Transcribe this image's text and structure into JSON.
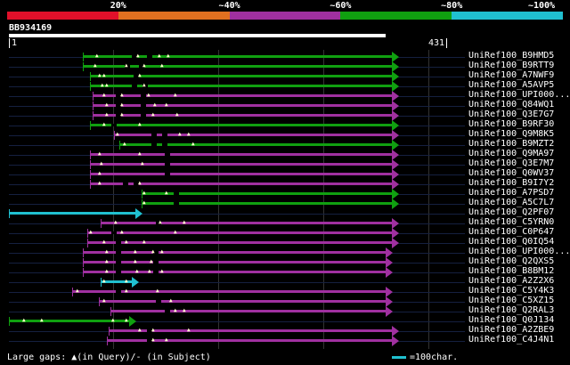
{
  "legend": {
    "segments": [
      {
        "color": "#e0102a"
      },
      {
        "color": "#e07020"
      },
      {
        "color": "#a030a0"
      },
      {
        "color": "#10a010"
      },
      {
        "color": "#20c0d0"
      }
    ],
    "labels": [
      "20%",
      "~40%",
      "~60%",
      "~80%",
      "~100%"
    ]
  },
  "query": {
    "id": "BB934169",
    "start": "1",
    "end": "431"
  },
  "hits": [
    {
      "name": "UniRef100_B9HMD5",
      "color": "#10a010",
      "start": 93,
      "end": 440,
      "arrow": true,
      "gaps": [
        148,
        165
      ],
      "marks": [
        107,
        153,
        177,
        187
      ]
    },
    {
      "name": "UniRef100_B9RTT9",
      "color": "#10a010",
      "start": 93,
      "end": 440,
      "arrow": true,
      "gaps": [
        140,
        156
      ],
      "marks": [
        105,
        140,
        160,
        180
      ]
    },
    {
      "name": "UniRef100_A7NWF9",
      "color": "#10a010",
      "start": 101,
      "end": 440,
      "arrow": true,
      "gaps": [
        150
      ],
      "marks": [
        110,
        115,
        155
      ]
    },
    {
      "name": "UniRef100_A5AVP5",
      "color": "#10a010",
      "start": 101,
      "end": 440,
      "arrow": true,
      "gaps": [
        148,
        160
      ],
      "marks": [
        113,
        118,
        160
      ]
    },
    {
      "name": "UniRef100_UPI000...",
      "color": "#a030a0",
      "start": 104,
      "end": 440,
      "arrow": true,
      "gaps": [
        130,
        158
      ],
      "marks": [
        115,
        135,
        165,
        195
      ]
    },
    {
      "name": "UniRef100_Q84WQ1",
      "color": "#a030a0",
      "start": 104,
      "end": 440,
      "arrow": true,
      "gaps": [
        130,
        158
      ],
      "marks": [
        118,
        135,
        172,
        185
      ]
    },
    {
      "name": "UniRef100_Q3E7G7",
      "color": "#a030a0",
      "start": 104,
      "end": 440,
      "arrow": true,
      "gaps": [
        130,
        158
      ],
      "marks": [
        118,
        135,
        170,
        197
      ]
    },
    {
      "name": "UniRef100_B9RF30",
      "color": "#10a010",
      "start": 101,
      "end": 440,
      "arrow": true,
      "gaps": [
        125
      ],
      "marks": [
        115,
        155
      ]
    },
    {
      "name": "UniRef100_Q9M8K5",
      "color": "#a030a0",
      "start": 128,
      "end": 440,
      "arrow": true,
      "gaps": [
        170,
        182
      ],
      "marks": [
        130,
        200,
        210
      ]
    },
    {
      "name": "UniRef100_B9MZT2",
      "color": "#10a010",
      "start": 134,
      "end": 440,
      "arrow": true,
      "gaps": [
        170,
        182
      ],
      "marks": [
        138,
        215
      ]
    },
    {
      "name": "UniRef100_Q9MA97",
      "color": "#a030a0",
      "start": 101,
      "end": 440,
      "arrow": true,
      "gaps": [
        185
      ],
      "marks": [
        110,
        155
      ]
    },
    {
      "name": "UniRef100_Q3E7M7",
      "color": "#a030a0",
      "start": 101,
      "end": 440,
      "arrow": true,
      "gaps": [
        185
      ],
      "marks": [
        112,
        158
      ]
    },
    {
      "name": "UniRef100_Q0WV37",
      "color": "#a030a0",
      "start": 101,
      "end": 440,
      "arrow": true,
      "gaps": [
        185
      ],
      "marks": [
        110
      ]
    },
    {
      "name": "UniRef100_B9I7Y2",
      "color": "#a030a0",
      "start": 101,
      "end": 440,
      "arrow": true,
      "gaps": [
        138,
        150
      ],
      "marks": [
        110,
        155
      ]
    },
    {
      "name": "UniRef100_A7PSD7",
      "color": "#10a010",
      "start": 159,
      "end": 440,
      "arrow": true,
      "gaps": [
        195
      ],
      "marks": [
        160,
        185
      ]
    },
    {
      "name": "UniRef100_A5C7L7",
      "color": "#10a010",
      "start": 159,
      "end": 440,
      "arrow": true,
      "gaps": [
        195
      ],
      "marks": [
        160
      ]
    },
    {
      "name": "UniRef100_Q2PF07",
      "color": "#20c0d0",
      "start": 10,
      "end": 152,
      "arrow": true,
      "gaps": [],
      "marks": []
    },
    {
      "name": "UniRef100_C5YRN0",
      "color": "#a030a0",
      "start": 113,
      "end": 440,
      "arrow": true,
      "gaps": [
        175
      ],
      "marks": [
        128,
        178,
        205
      ]
    },
    {
      "name": "UniRef100_C0P647",
      "color": "#a030a0",
      "start": 98,
      "end": 440,
      "arrow": true,
      "gaps": [
        125
      ],
      "marks": [
        100,
        135,
        195
      ]
    },
    {
      "name": "UniRef100_Q0IQ54",
      "color": "#a030a0",
      "start": 98,
      "end": 440,
      "arrow": true,
      "gaps": [
        130
      ],
      "marks": [
        115,
        140,
        160
      ]
    },
    {
      "name": "UniRef100_UPI000...",
      "color": "#a030a0",
      "start": 93,
      "end": 433,
      "arrow": true,
      "gaps": [
        130,
        172
      ],
      "marks": [
        118,
        150,
        170,
        180
      ]
    },
    {
      "name": "UniRef100_Q2QXS5",
      "color": "#a030a0",
      "start": 93,
      "end": 433,
      "arrow": true,
      "gaps": [
        130,
        172
      ],
      "marks": [
        118,
        150,
        168
      ]
    },
    {
      "name": "UniRef100_B8BM12",
      "color": "#a030a0",
      "start": 93,
      "end": 433,
      "arrow": true,
      "gaps": [
        130,
        172
      ],
      "marks": [
        118,
        152,
        166,
        180
      ]
    },
    {
      "name": "UniRef100_A2Z2X6",
      "color": "#20c0d0",
      "start": 113,
      "end": 148,
      "arrow": true,
      "gaps": [],
      "marks": [
        115,
        140
      ]
    },
    {
      "name": "UniRef100_C5Y4K3",
      "color": "#a030a0",
      "start": 81,
      "end": 433,
      "arrow": true,
      "gaps": [
        130
      ],
      "marks": [
        85,
        140,
        175
      ]
    },
    {
      "name": "UniRef100_C5XZ15",
      "color": "#a030a0",
      "start": 111,
      "end": 433,
      "arrow": true,
      "gaps": [
        175
      ],
      "marks": [
        115,
        190
      ]
    },
    {
      "name": "UniRef100_Q2RAL3",
      "color": "#a030a0",
      "start": 124,
      "end": 433,
      "arrow": true,
      "gaps": [
        185
      ],
      "marks": [
        195,
        205
      ]
    },
    {
      "name": "UniRef100_Q0J134",
      "color": "#10a010",
      "start": 10,
      "end": 145,
      "arrow": true,
      "gaps": [],
      "marks": [
        25,
        45,
        125,
        140
      ]
    },
    {
      "name": "UniRef100_A2ZBE9",
      "color": "#a030a0",
      "start": 122,
      "end": 440,
      "arrow": true,
      "gaps": [
        165
      ],
      "marks": [
        155,
        170,
        210
      ]
    },
    {
      "name": "UniRef100_C4J4N1",
      "color": "#a030a0",
      "start": 120,
      "end": 440,
      "arrow": true,
      "gaps": [
        165
      ],
      "marks": [
        170,
        185
      ]
    }
  ],
  "footer": {
    "gaps_text": "Large gaps: ▲(in Query)/- (in Subject)",
    "scale_text": "=100char."
  }
}
